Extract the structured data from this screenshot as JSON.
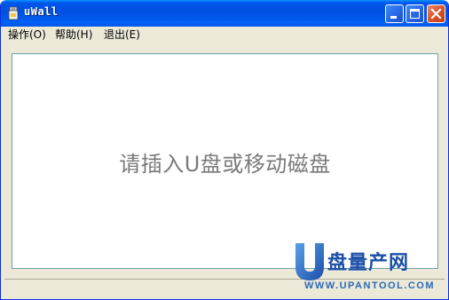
{
  "window": {
    "title": "uWall"
  },
  "menu": {
    "items": [
      {
        "label": "操作(O)"
      },
      {
        "label": "帮助(H)"
      },
      {
        "label": "退出(E)"
      }
    ]
  },
  "main": {
    "prompt": "请插入U盘或移动磁盘"
  },
  "watermark": {
    "brand_cn": "盘量产网",
    "url": "WWW.UPANTOOL.COM"
  },
  "colors": {
    "titlebar": "#0054e3",
    "close_button": "#d8542a",
    "window_bg": "#ece9d8",
    "panel_border": "#6b9fa8",
    "prompt_text": "#7a7a7a",
    "watermark_blue": "#1b4fa8"
  },
  "icons": {
    "app": "usb-drive-icon",
    "minimize": "minimize-icon",
    "maximize": "maximize-icon",
    "close": "close-icon"
  }
}
